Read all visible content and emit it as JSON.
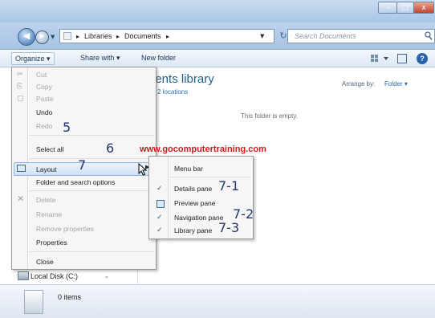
{
  "window": {
    "controls": {
      "minimize": "–",
      "maximize": "□",
      "close": "x"
    }
  },
  "address": {
    "crumbs": [
      "Libraries",
      "Documents"
    ],
    "search_placeholder": "Search Documents"
  },
  "toolbar": {
    "organize": "Organize ▾",
    "share_with": "Share with ▾",
    "new_folder": "New folder",
    "help": "?"
  },
  "library": {
    "title": "nents library",
    "locations": "2 locations",
    "arrange_label": "Arrange by:",
    "arrange_value": "Folder ▾",
    "empty_message": "This folder is empty."
  },
  "nav_pane": {
    "local_disk": "Local Disk (C:)"
  },
  "details_pane": {
    "item_count": "0 items"
  },
  "organize_menu": {
    "items": [
      {
        "label": "Cut",
        "enabled": false
      },
      {
        "label": "Copy",
        "enabled": false
      },
      {
        "label": "Paste",
        "enabled": false
      },
      {
        "label": "Undo",
        "enabled": true
      },
      {
        "label": "Redo",
        "enabled": false
      },
      {
        "label": "Select all",
        "enabled": true
      },
      {
        "label": "Layout",
        "enabled": true,
        "highlighted": true
      },
      {
        "label": "Folder and search options",
        "enabled": true
      },
      {
        "label": "Delete",
        "enabled": false
      },
      {
        "label": "Rename",
        "enabled": false
      },
      {
        "label": "Remove properties",
        "enabled": false
      },
      {
        "label": "Properties",
        "enabled": true
      },
      {
        "label": "Close",
        "enabled": true
      }
    ]
  },
  "layout_submenu": {
    "items": [
      {
        "label": "Menu bar",
        "checked": false
      },
      {
        "label": "Details pane",
        "checked": true
      },
      {
        "label": "Preview pane",
        "checked": false
      },
      {
        "label": "Navigation pane",
        "checked": true
      },
      {
        "label": "Library pane",
        "checked": true
      }
    ],
    "check_glyph": "✓"
  },
  "annotations": {
    "redo": "5",
    "select_all": "6",
    "layout": "7",
    "details_pane": "7-1",
    "navigation_pane": "7-2",
    "library_pane": "7-3"
  },
  "watermark": "www.gocomputertraining.com",
  "colors": {
    "accent": "#2b6fb0",
    "watermark": "#d11b1b",
    "annotation": "#22356e",
    "library_title": "#1f5f8e"
  }
}
